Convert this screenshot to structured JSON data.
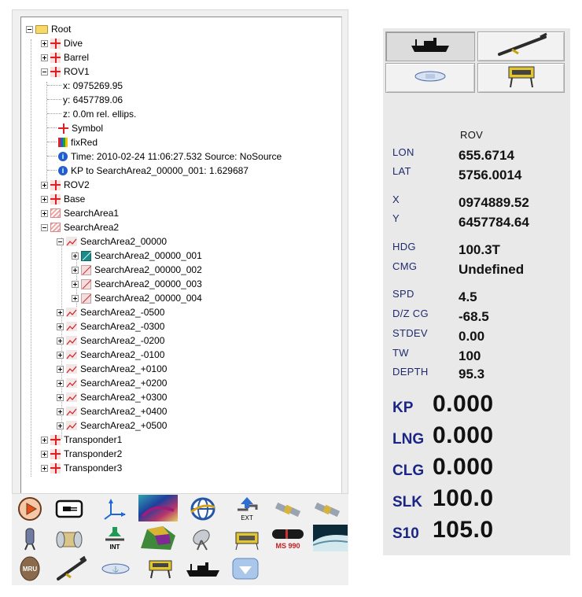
{
  "tree": {
    "root": "Root",
    "dive": "Dive",
    "barrel": "Barrel",
    "rov1": "ROV1",
    "x": "x:  0975269.95",
    "y": "y:  6457789.06",
    "z": "z:  0.0m rel. ellips.",
    "symbol": "Symbol",
    "fixred": "fixRed",
    "time": "Time: 2010-02-24 11:06:27.532     Source: NoSource",
    "kp": "KP to SearchArea2_00000_001: 1.629687",
    "rov2": "ROV2",
    "base": "Base",
    "sa1": "SearchArea1",
    "sa2": "SearchArea2",
    "sa2_00000": "SearchArea2_00000",
    "sub": [
      "SearchArea2_00000_001",
      "SearchArea2_00000_002",
      "SearchArea2_00000_003",
      "SearchArea2_00000_004"
    ],
    "lines": [
      "SearchArea2_-0500",
      "SearchArea2_-0300",
      "SearchArea2_-0200",
      "SearchArea2_-0100",
      "SearchArea2_+0100",
      "SearchArea2_+0200",
      "SearchArea2_+0300",
      "SearchArea2_+0400",
      "SearchArea2_+0500"
    ],
    "t1": "Transponder1",
    "t2": "Transponder2",
    "t3": "Transponder3"
  },
  "toolbar": {
    "ext": "EXT",
    "int": "INT",
    "ms990": "MS 990",
    "mru": "MRU",
    "icons": [
      "play-icon",
      "plug-icon",
      "axes-icon",
      "bathymetry-map-icon",
      "globe-icon",
      "export-icon",
      "satellite-icon",
      "satellite-2-icon",
      "hydrophone-icon",
      "cable-drum-icon",
      "import-icon",
      "terrain-icon",
      "dish-icon",
      "rov-frame-icon",
      "ms990-icon",
      "seabed-icon",
      "mru-icon",
      "towfish-icon",
      "auv-icon",
      "rov-icon",
      "ship-icon",
      "download-icon"
    ]
  },
  "nav": {
    "vessel_buttons": [
      "ship-icon",
      "towfish-icon",
      "auv-icon",
      "rov-icon"
    ],
    "header": "ROV",
    "rows": [
      {
        "label": "LON",
        "value": "655.6714"
      },
      {
        "label": "LAT",
        "value": "5756.0014"
      },
      {
        "label": "X",
        "value": "0974889.52"
      },
      {
        "label": "Y",
        "value": "6457784.64"
      },
      {
        "label": "HDG",
        "value": "100.3T"
      },
      {
        "label": "CMG",
        "value": "Undefined"
      },
      {
        "label": "SPD",
        "value": "4.5"
      },
      {
        "label": "D/Z CG",
        "value": "-68.5"
      },
      {
        "label": "STDEV",
        "value": "0.00"
      },
      {
        "label": "TW",
        "value": "100"
      },
      {
        "label": "DEPTH",
        "value": "95.3"
      }
    ],
    "big": [
      {
        "label": "KP",
        "value": "0.000"
      },
      {
        "label": "LNG",
        "value": "0.000"
      },
      {
        "label": "CLG",
        "value": "0.000"
      },
      {
        "label": "SLK",
        "value": "100.0"
      },
      {
        "label": "S10",
        "value": "105.0"
      }
    ]
  },
  "colors": {
    "accent_red": "#e02020",
    "label_blue": "#1f2a6e",
    "hatch_red": "#f3a2a2"
  }
}
